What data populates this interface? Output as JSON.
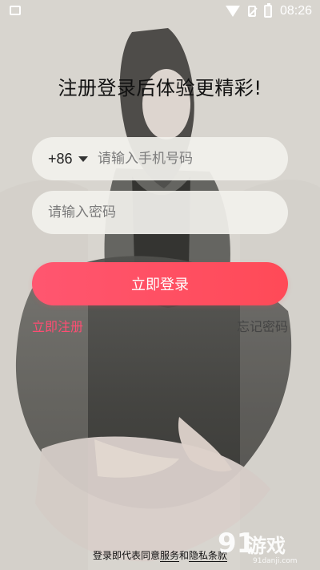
{
  "status_bar": {
    "time": "08:26",
    "icons": [
      "image-icon",
      "wifi-icon",
      "sim-off-icon",
      "battery-charging-icon"
    ]
  },
  "title": "注册登录后体验更精彩!",
  "phone": {
    "country_code": "+86",
    "placeholder": "请输入手机号码"
  },
  "password": {
    "placeholder": "请输入密码"
  },
  "buttons": {
    "login": "立即登录",
    "register": "立即注册",
    "forgot_password": "忘记密码"
  },
  "agreement": {
    "prefix": "登录即代表同意",
    "service": "服务",
    "and": "和",
    "privacy": "隐私条款"
  },
  "watermark": {
    "brand": "91游戏",
    "url": "91danji.com"
  },
  "colors": {
    "accent": "#ff4d73",
    "button_gradient_start": "#ff5670",
    "button_gradient_end": "#ff4a57",
    "field_background": "#f2f1ed"
  }
}
